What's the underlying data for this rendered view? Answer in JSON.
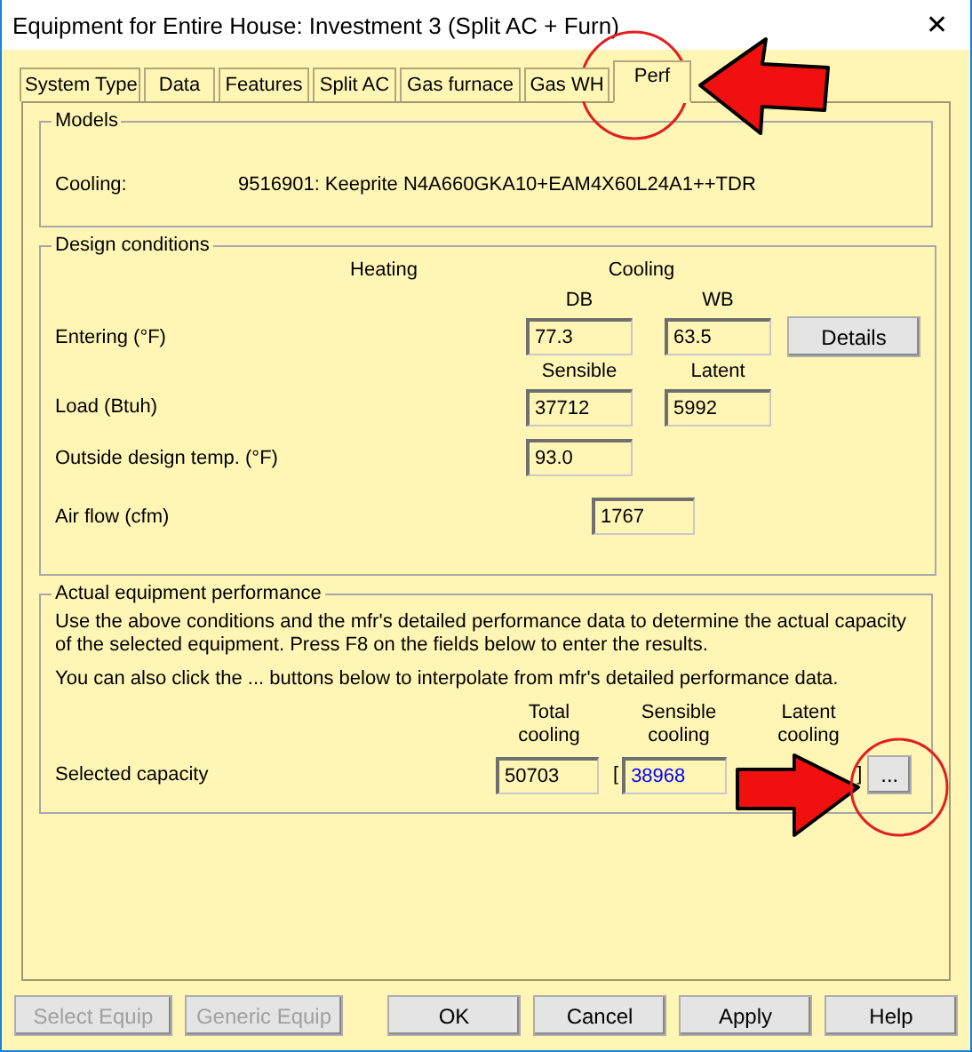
{
  "window": {
    "title": "Equipment for Entire House: Investment 3 (Split AC + Furn)",
    "close": "✕"
  },
  "tabs": [
    {
      "label": "System Type",
      "selected": false
    },
    {
      "label": "Data",
      "selected": false
    },
    {
      "label": "Features",
      "selected": false
    },
    {
      "label": "Split AC",
      "selected": false
    },
    {
      "label": "Gas furnace",
      "selected": false
    },
    {
      "label": "Gas WH",
      "selected": false
    },
    {
      "label": "Perf",
      "selected": true
    }
  ],
  "models": {
    "title": "Models",
    "label": "Cooling:",
    "value": "9516901: Keeprite N4A660GKA10+EAM4X60L24A1++TDR"
  },
  "design_conditions": {
    "title": "Design conditions",
    "heating_heading": "Heating",
    "cooling_heading": "Cooling",
    "entering": {
      "label": "Entering (°F)",
      "col_1": "DB",
      "col_2": "WB",
      "value_1": "77.3",
      "value_2": "63.5",
      "button": "Details"
    },
    "load": {
      "label": "Load (Btuh)",
      "col_1": "Sensible",
      "col_2": "Latent",
      "value_1": "37712",
      "value_2": "5992"
    },
    "outside": {
      "label": "Outside design temp. (°F)",
      "value": "93.0"
    },
    "airflow": {
      "label": "Air flow (cfm)",
      "value": "1767"
    }
  },
  "performance": {
    "title": "Actual equipment performance",
    "paragraph_1": "Use the above conditions and the mfr's detailed performance data to determine the actual capacity of the selected equipment.  Press F8 on the fields below to enter the results.",
    "paragraph_2": "You can also click the ... buttons below to interpolate from mfr's detailed performance data.",
    "columns": [
      "Total cooling",
      "Sensible cooling",
      "Latent cooling"
    ],
    "row_label": "Selected capacity",
    "total": "50703",
    "open_bracket": "[",
    "sensible": "38968",
    "close_bracket": "]",
    "interpolate_button": "..."
  },
  "buttons": [
    {
      "label": "Select Equip",
      "disabled": true
    },
    {
      "label": "Generic Equip",
      "disabled": true
    },
    {
      "label": "OK",
      "disabled": false
    },
    {
      "label": "Cancel",
      "disabled": false
    },
    {
      "label": "Apply",
      "disabled": false
    },
    {
      "label": "Help",
      "disabled": false
    }
  ]
}
